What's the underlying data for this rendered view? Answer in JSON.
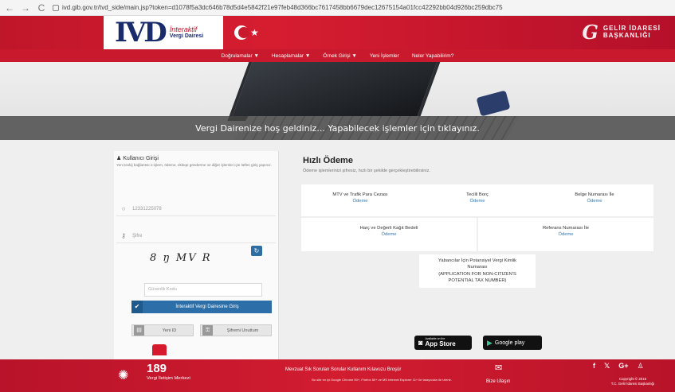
{
  "browser": {
    "back": "←",
    "forward": "→",
    "reload": "C",
    "url": "ivd.gib.gov.tr/tvd_side/main.jsp?token=d1078f5a3dc646b78d5d4e5842f21e97feb48d366bc7617458bb6679dec12675154a01fcc42292bb04d926bc259dbc75"
  },
  "header": {
    "logo_mark": "IVD",
    "logo_line1": "İnteraktif",
    "logo_line2": "Vergi Dairesi",
    "gib_line1": "GELİR İDARESİ",
    "gib_line2": "BAŞKANLIĞI"
  },
  "topnav": {
    "items": [
      "Doğrulamalar ▼",
      "Hesaplamalar ▼",
      "Örnek Girişi ▼",
      "Yeni İşlemler",
      "Neler Yapabilirim?"
    ]
  },
  "hero": {
    "welcome": "Vergi Dairenize hoş geldiniz... Yapabilecek işlemler için tıklayınız."
  },
  "login": {
    "title": "Kullanıcı Girişi",
    "description": "Yeni tevkij bağlantısı e-işlem, ödeme, ekleqe gönderme ve diğer işlemler için lütfen giriş yapınız.",
    "username": "12331225078",
    "password_placeholder": "Şifre",
    "captcha": "8 ŋ MV R",
    "captcha_placeholder": "Güvenlik Kodu",
    "login_button": "İnteraktif Vergi Dairesine Giriş",
    "giris_button": "Yeni ID",
    "forgot_button": "Şifremi Unuttum"
  },
  "payment": {
    "title": "Hızlı Ödeme",
    "subtitle": "Ödeme işlemlerinizi şifresiz, hızlı bir şekilde gerçekleştirebilirsiniz.",
    "link_label": "Ödeme",
    "items": [
      "MTV ve Trafik Para Cezası",
      "Tecilli Borç",
      "Belge Numarası İle",
      "Harç ve Değerli Kağıt Bedeli",
      "Referans Numarası İle"
    ],
    "foreign_line1": "Yabancılar İçin Potansiyel Vergi Kimlik",
    "foreign_line2": "Numarası",
    "foreign_line3": "(APPLICATION FOR NON-CITIZEN'S",
    "foreign_line4": "POTENTIAL TAX NUMBER)"
  },
  "stores": {
    "apple_small": "Available on the",
    "apple": "App Store",
    "google": "Google play"
  },
  "footer": {
    "number": "189",
    "number_label": "Vergi İletişim Merkezi",
    "links": "Mevzuat  Sık Sorulan Sorular  Kullanım Kılavuzu  Broşür",
    "note": "Bu site en iyi Google Chrome 50+, Firefox 50+ ve MS Internet Explorer 11+ ile tarayıcıları ile izlenir.",
    "contact": "Bize Ulaşın",
    "social": [
      "f",
      "𝕏",
      "G+",
      "♙"
    ],
    "copyright1": "Copyright © 2016",
    "copyright2": "T.C. Gelir İdaresi Başkanlığı"
  },
  "colors": {
    "brand_red": "#c81a2c",
    "link_blue": "#2f7ab8",
    "button_blue": "#2b6ea8"
  }
}
